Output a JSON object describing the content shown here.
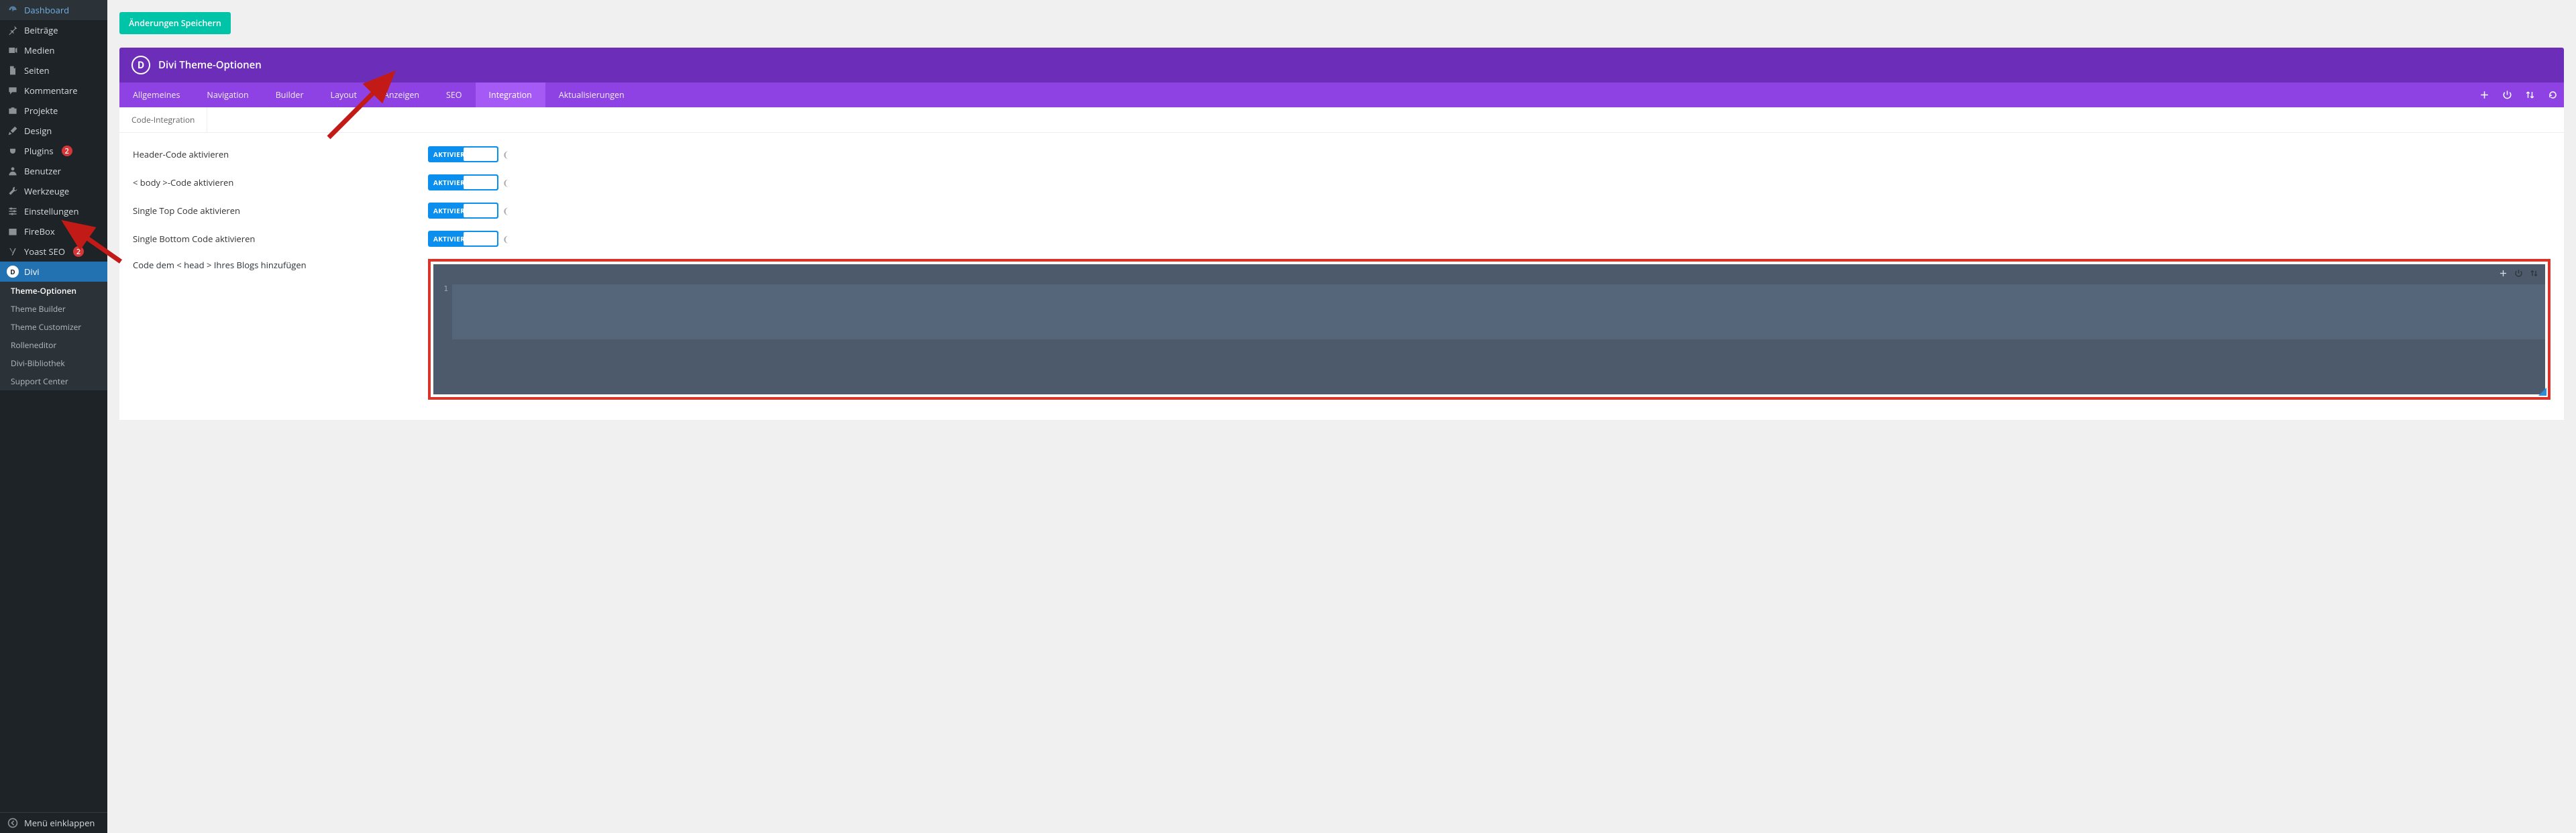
{
  "sidebar": {
    "items": [
      {
        "icon": "gauge",
        "label": "Dashboard"
      },
      {
        "icon": "pin",
        "label": "Beiträge"
      },
      {
        "icon": "media",
        "label": "Medien"
      },
      {
        "icon": "page",
        "label": "Seiten"
      },
      {
        "icon": "chat",
        "label": "Kommentare"
      },
      {
        "icon": "portfolio",
        "label": "Projekte"
      },
      {
        "icon": "brush",
        "label": "Design"
      },
      {
        "icon": "plug",
        "label": "Plugins",
        "badge": "2"
      },
      {
        "icon": "user",
        "label": "Benutzer"
      },
      {
        "icon": "wrench",
        "label": "Werkzeuge"
      },
      {
        "icon": "sliders",
        "label": "Einstellungen"
      },
      {
        "icon": "box",
        "label": "FireBox"
      },
      {
        "icon": "yoast",
        "label": "Yoast SEO",
        "badge": "2"
      },
      {
        "icon": "divi",
        "label": "Divi",
        "current": true
      }
    ],
    "submenu": [
      {
        "label": "Theme-Optionen",
        "active": true
      },
      {
        "label": "Theme Builder"
      },
      {
        "label": "Theme Customizer"
      },
      {
        "label": "Rolleneditor"
      },
      {
        "label": "Divi-Bibliothek"
      },
      {
        "label": "Support Center"
      }
    ],
    "collapse_label": "Menü einklappen"
  },
  "save_button": "Änderungen Speichern",
  "panel_title": "Divi Theme-Optionen",
  "tabs": [
    {
      "label": "Allgemeines"
    },
    {
      "label": "Navigation"
    },
    {
      "label": "Builder"
    },
    {
      "label": "Layout"
    },
    {
      "label": "Anzeigen"
    },
    {
      "label": "SEO"
    },
    {
      "label": "Integration",
      "active": true
    },
    {
      "label": "Aktualisierungen"
    }
  ],
  "subtab_label": "Code-Integration",
  "toggle_state_label": "AKTIVIEREN",
  "options": [
    {
      "label": "Header-Code aktivieren"
    },
    {
      "label": "< body >-Code aktivieren"
    },
    {
      "label": "Single Top Code aktivieren"
    },
    {
      "label": "Single Bottom Code aktivieren"
    }
  ],
  "code_label": "Code dem < head > Ihres Blogs hinzufügen",
  "code_line_number": "1"
}
